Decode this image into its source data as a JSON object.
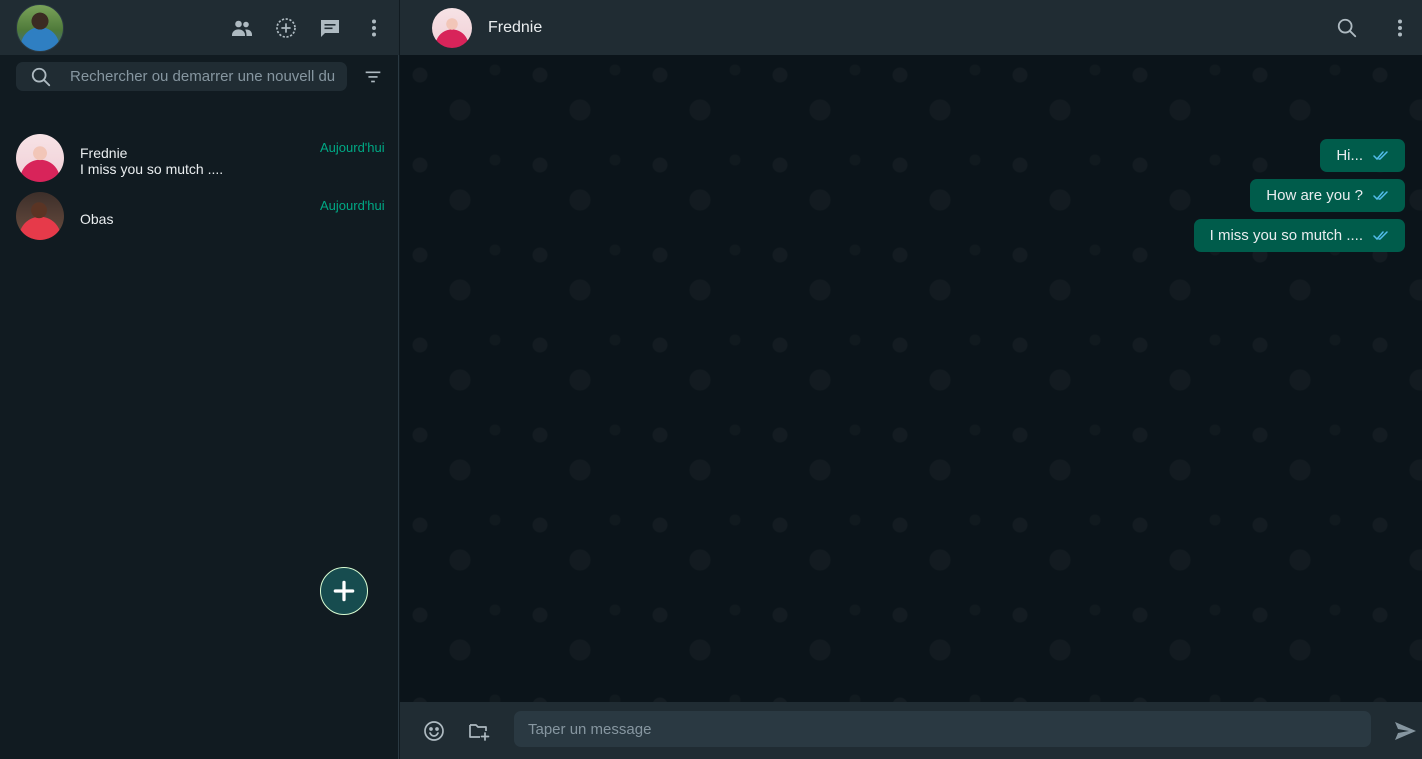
{
  "colors": {
    "accent": "#00a884",
    "bubble_outgoing": "#005c4b",
    "panel": "#202c33",
    "background": "#111b21",
    "read_ticks": "#53bdeb"
  },
  "sidebar": {
    "header_icons": [
      "community-icon",
      "status-icon",
      "new-chat-icon",
      "menu-icon"
    ],
    "search": {
      "placeholder": "Rechercher ou demarrer une nouvell du",
      "value": ""
    },
    "chats": [
      {
        "name": "Frednie",
        "preview": "I miss you so mutch ....",
        "time": "Aujourd'hui"
      },
      {
        "name": "Obas",
        "preview": "",
        "time": "Aujourd'hui"
      }
    ],
    "fab_icon": "plus-icon"
  },
  "conversation": {
    "contact_name": "Frednie",
    "messages": [
      {
        "text": "Hi...",
        "status": "read"
      },
      {
        "text": "How are you ?",
        "status": "read"
      },
      {
        "text": "I miss you so mutch ....",
        "status": "read"
      }
    ],
    "composer": {
      "placeholder": "Taper un message",
      "value": ""
    }
  }
}
